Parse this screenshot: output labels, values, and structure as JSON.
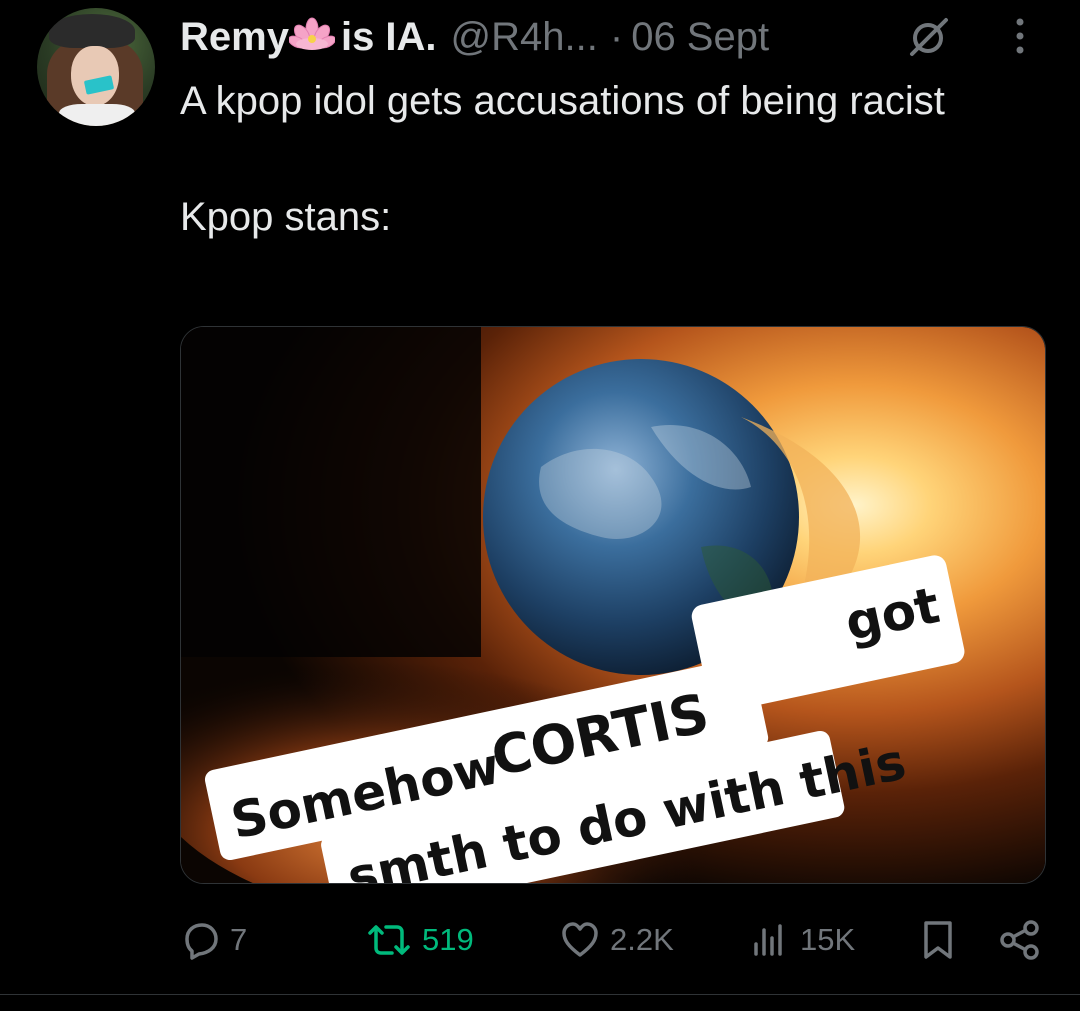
{
  "tweet": {
    "display_name": "Remy",
    "display_name_suffix": "is IA.",
    "handle": "@R4h...",
    "separator": "·",
    "date": "06 Sept",
    "text_line1": "A kpop idol gets accusations of being racist",
    "text_line2": "Kpop stans:"
  },
  "media": {
    "caption_word1": "Somehow",
    "caption_word2": "CORTIS",
    "caption_word3": "got",
    "caption_line2": "smth to do with this"
  },
  "actions": {
    "replies": "7",
    "reposts": "519",
    "likes": "2.2K",
    "views": "15K"
  },
  "colors": {
    "background": "#000000",
    "text": "#e7e9ea",
    "muted": "#71767b",
    "repost_active": "#00ba7c",
    "border": "#2f3336"
  },
  "icons": [
    "flower-emoji-icon",
    "mute-icon",
    "more-icon",
    "reply-icon",
    "repost-icon",
    "like-icon",
    "views-icon",
    "bookmark-icon",
    "share-icon"
  ]
}
